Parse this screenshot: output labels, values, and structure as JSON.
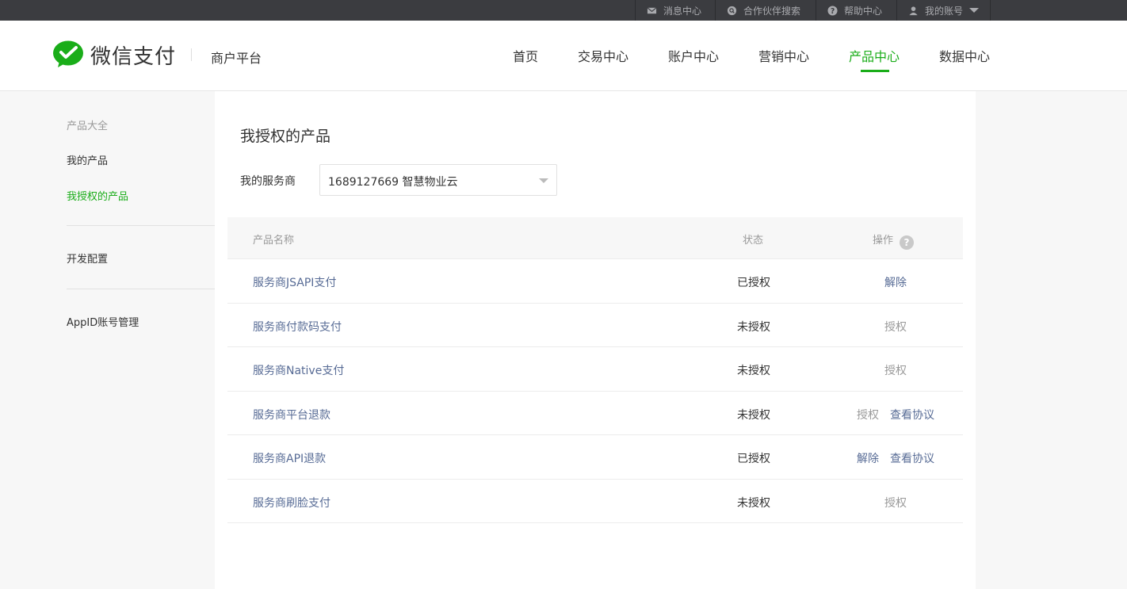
{
  "topbar": {
    "items": [
      {
        "label": "消息中心",
        "icon": "mail-icon"
      },
      {
        "label": "合作伙伴搜索",
        "icon": "search-icon"
      },
      {
        "label": "帮助中心",
        "icon": "help-icon"
      },
      {
        "label": "我的账号",
        "icon": "user-icon"
      }
    ]
  },
  "header": {
    "logo_text": "微信支付",
    "subtitle": "商户平台",
    "nav": [
      {
        "label": "首页"
      },
      {
        "label": "交易中心"
      },
      {
        "label": "账户中心"
      },
      {
        "label": "营销中心"
      },
      {
        "label": "产品中心",
        "active": true
      },
      {
        "label": "数据中心"
      }
    ]
  },
  "sidebar": {
    "group_title": "产品大全",
    "items": [
      {
        "label": "我的产品"
      },
      {
        "label": "我授权的产品",
        "active": true
      },
      {
        "label": "开发配置"
      },
      {
        "label": "AppID账号管理"
      }
    ]
  },
  "main": {
    "title": "我授权的产品",
    "service_provider_label": "我的服务商",
    "service_provider_value": "1689127669 智慧物业云",
    "table": {
      "headers": [
        "产品名称",
        "状态",
        "操作"
      ],
      "rows": [
        {
          "name": "服务商JSAPI支付",
          "status": "已授权",
          "ops": [
            {
              "label": "解除",
              "style": "link"
            }
          ]
        },
        {
          "name": "服务商付款码支付",
          "status": "未授权",
          "ops": [
            {
              "label": "授权",
              "style": "muted"
            }
          ]
        },
        {
          "name": "服务商Native支付",
          "status": "未授权",
          "ops": [
            {
              "label": "授权",
              "style": "muted"
            }
          ]
        },
        {
          "name": "服务商平台退款",
          "status": "未授权",
          "ops": [
            {
              "label": "授权",
              "style": "muted"
            },
            {
              "label": "查看协议",
              "style": "link"
            }
          ]
        },
        {
          "name": "服务商API退款",
          "status": "已授权",
          "ops": [
            {
              "label": "解除",
              "style": "link"
            },
            {
              "label": "查看协议",
              "style": "link"
            }
          ]
        },
        {
          "name": "服务商刷脸支付",
          "status": "未授权",
          "ops": [
            {
              "label": "授权",
              "style": "muted"
            }
          ]
        }
      ]
    }
  },
  "colors": {
    "brand_green": "#1aad19",
    "link_blue": "#576b95",
    "topbar_bg": "#3b3c40"
  }
}
